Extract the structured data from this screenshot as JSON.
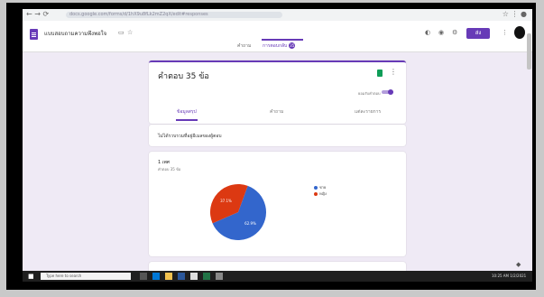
{
  "browser": {
    "nav_icons": "←  →  ⟳",
    "url": "docs.google.com/forms/d/1hX9u8fLk2mZ2qX/edit#responses",
    "right_icons": "☆  ⋮  ●"
  },
  "header": {
    "form_title": "แบบสอบถามความพึงพอใจ",
    "send_label": "ส่ง",
    "icons": [
      "palette-icon",
      "eye-icon",
      "settings-icon"
    ]
  },
  "top_tabs": {
    "questions": "คำถาม",
    "responses": "การตอบกลับ",
    "responses_badge": "35"
  },
  "summary_card": {
    "response_count": "คำตอบ 35 ข้อ",
    "accepting_label": "ยอมรับคำตอบ",
    "tabs": [
      "ข้อมูลสรุป",
      "คำถาม",
      "แต่ละรายการ"
    ]
  },
  "email_card": {
    "text": "ไม่ได้รวบรวมที่อยู่อีเมลของผู้ตอบ"
  },
  "question_card": {
    "title": "1 เพศ",
    "subtitle": "คำตอบ 35 ข้อ"
  },
  "chart_data": {
    "type": "pie",
    "title": "",
    "categories": [
      "ชาย",
      "หญิง"
    ],
    "values": [
      62.9,
      37.1
    ],
    "labels": [
      "62.9%",
      "37.1%"
    ],
    "colors": [
      "#3366cc",
      "#dc3912"
    ]
  },
  "taskbar": {
    "search_placeholder": "Type here to search",
    "clock": "10:25 AM  1/2/2021"
  }
}
